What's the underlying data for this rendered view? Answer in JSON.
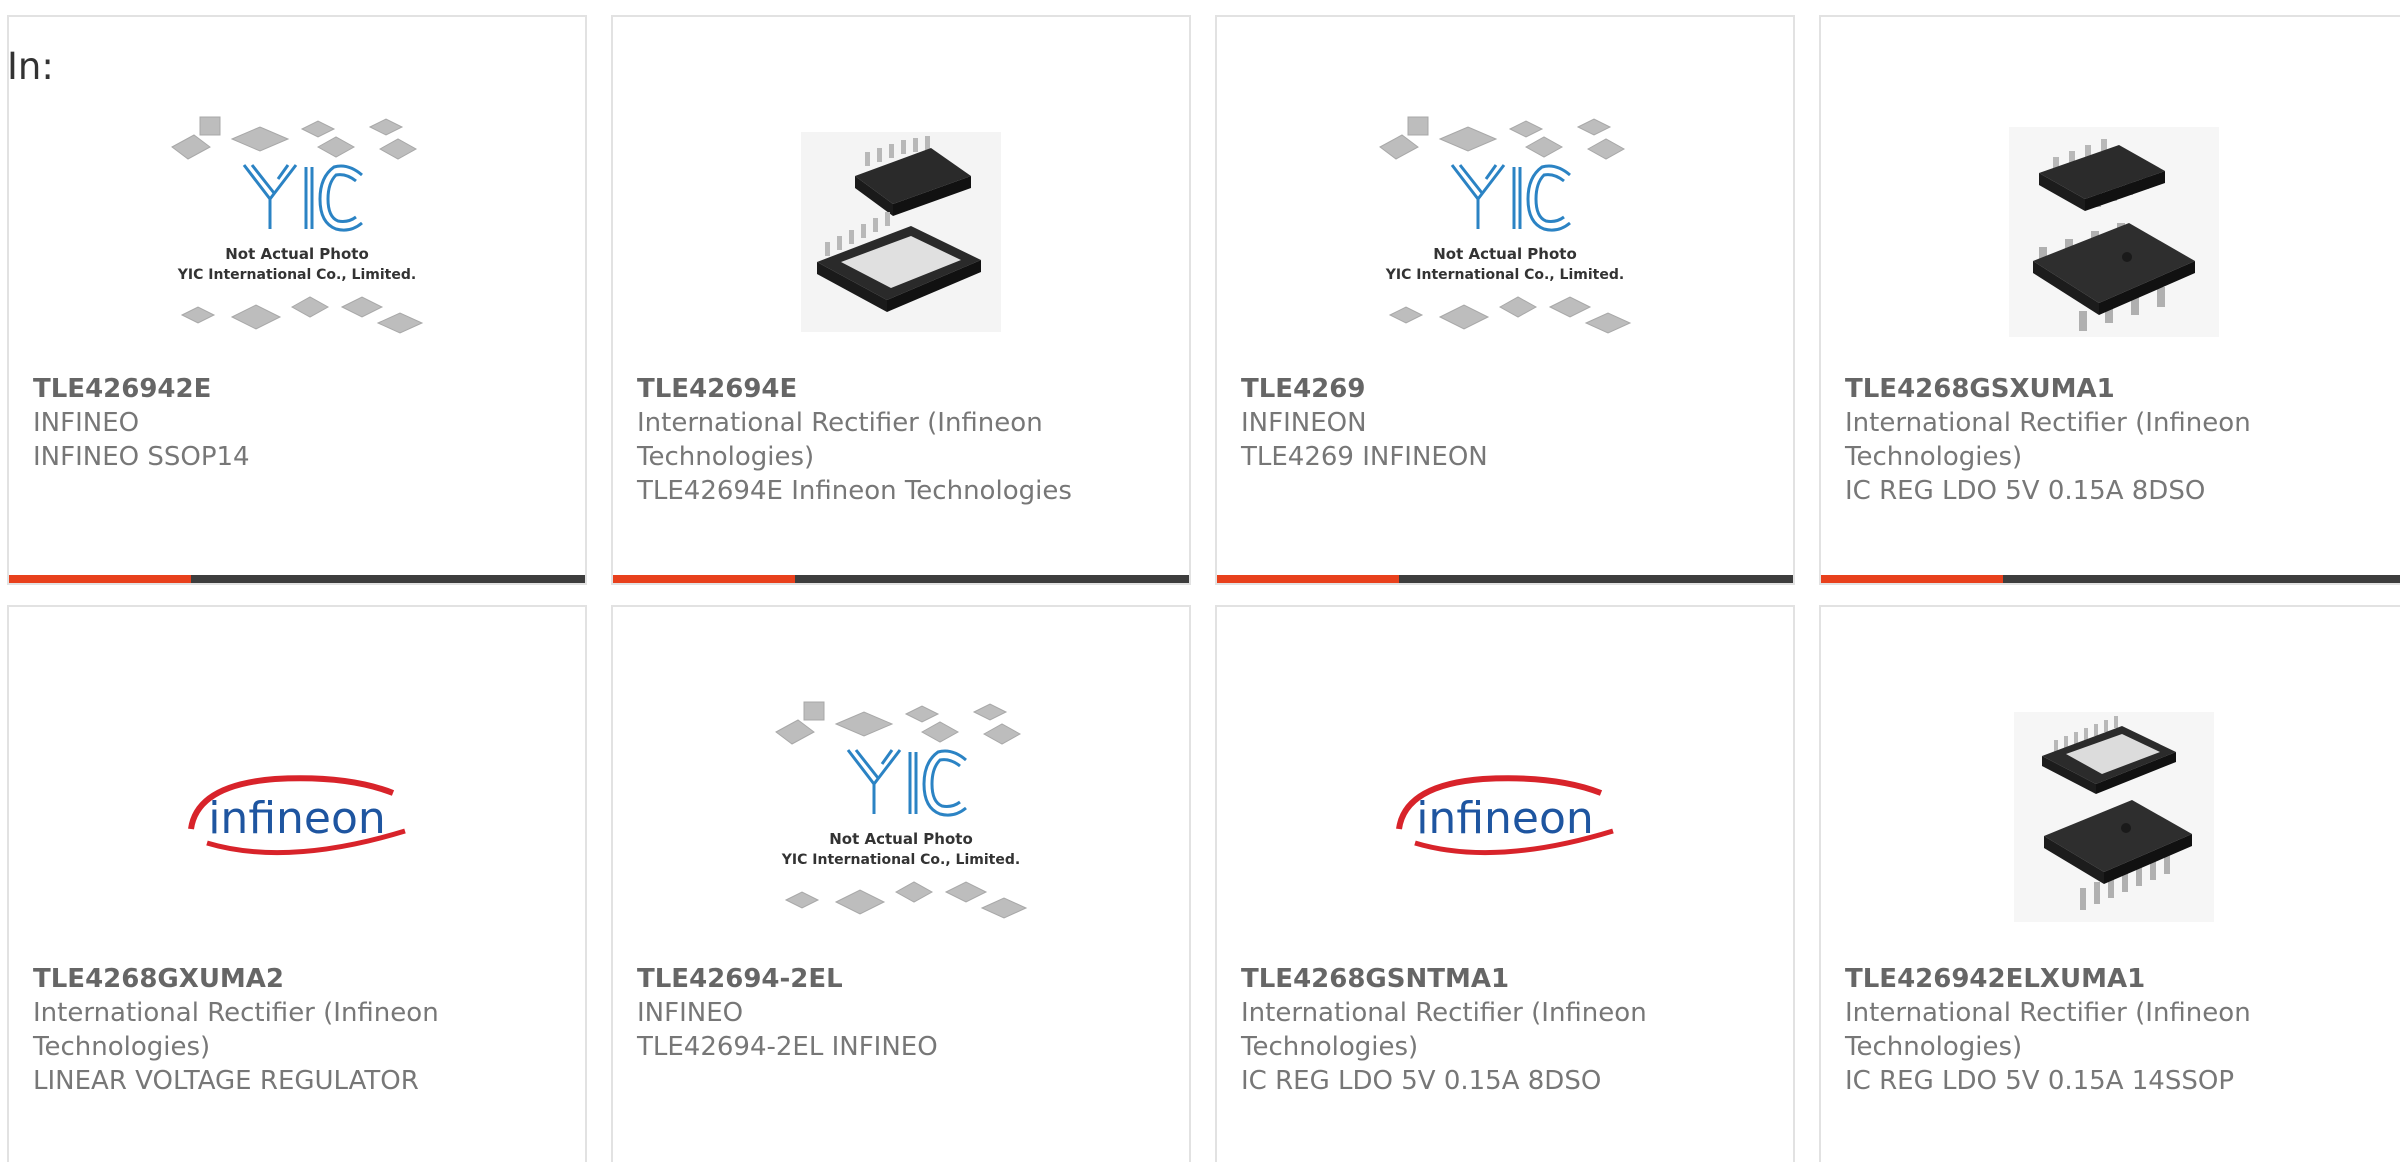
{
  "label": "In:",
  "colors": {
    "accent": "#e8401c",
    "bar": "#3d3d3d",
    "infineon_blue": "#1e55a0",
    "infineon_red": "#d8232a",
    "yic_blue": "#2b83c4"
  },
  "yic": {
    "logo": "YIC",
    "line1": "Not Actual Photo",
    "line2": "YIC International Co., Limited."
  },
  "infineon_logo": "infineon",
  "products": [
    {
      "part": "TLE426942E",
      "manufacturer": "INFINEO",
      "description": "INFINEO SSOP14",
      "image": "yic-placeholder"
    },
    {
      "part": "TLE42694E",
      "manufacturer": "International Rectifier (Infineon Technologies)",
      "description": "TLE42694E Infineon Technologies",
      "image": "chip-ssop14"
    },
    {
      "part": "TLE4269",
      "manufacturer": "INFINEON",
      "description": "TLE4269 INFINEON",
      "image": "yic-placeholder"
    },
    {
      "part": "TLE4268GSXUMA1",
      "manufacturer": "International Rectifier (Infineon Technologies)",
      "description": "IC REG LDO 5V 0.15A 8DSO",
      "image": "chip-8dso"
    },
    {
      "part": "TLE4268GXUMA2",
      "manufacturer": "International Rectifier (Infineon Technologies)",
      "description": "LINEAR VOLTAGE REGULATOR",
      "image": "infineon-logo"
    },
    {
      "part": "TLE42694-2EL",
      "manufacturer": "INFINEO",
      "description": "TLE42694-2EL INFINEO",
      "image": "yic-placeholder"
    },
    {
      "part": "TLE4268GSNTMA1",
      "manufacturer": "International Rectifier (Infineon Technologies)",
      "description": "IC REG LDO 5V 0.15A 8DSO",
      "image": "infineon-logo"
    },
    {
      "part": "TLE426942ELXUMA1",
      "manufacturer": "International Rectifier (Infineon Technologies)",
      "description": "IC REG LDO 5V 0.15A 14SSOP",
      "image": "chip-14ssop"
    }
  ]
}
